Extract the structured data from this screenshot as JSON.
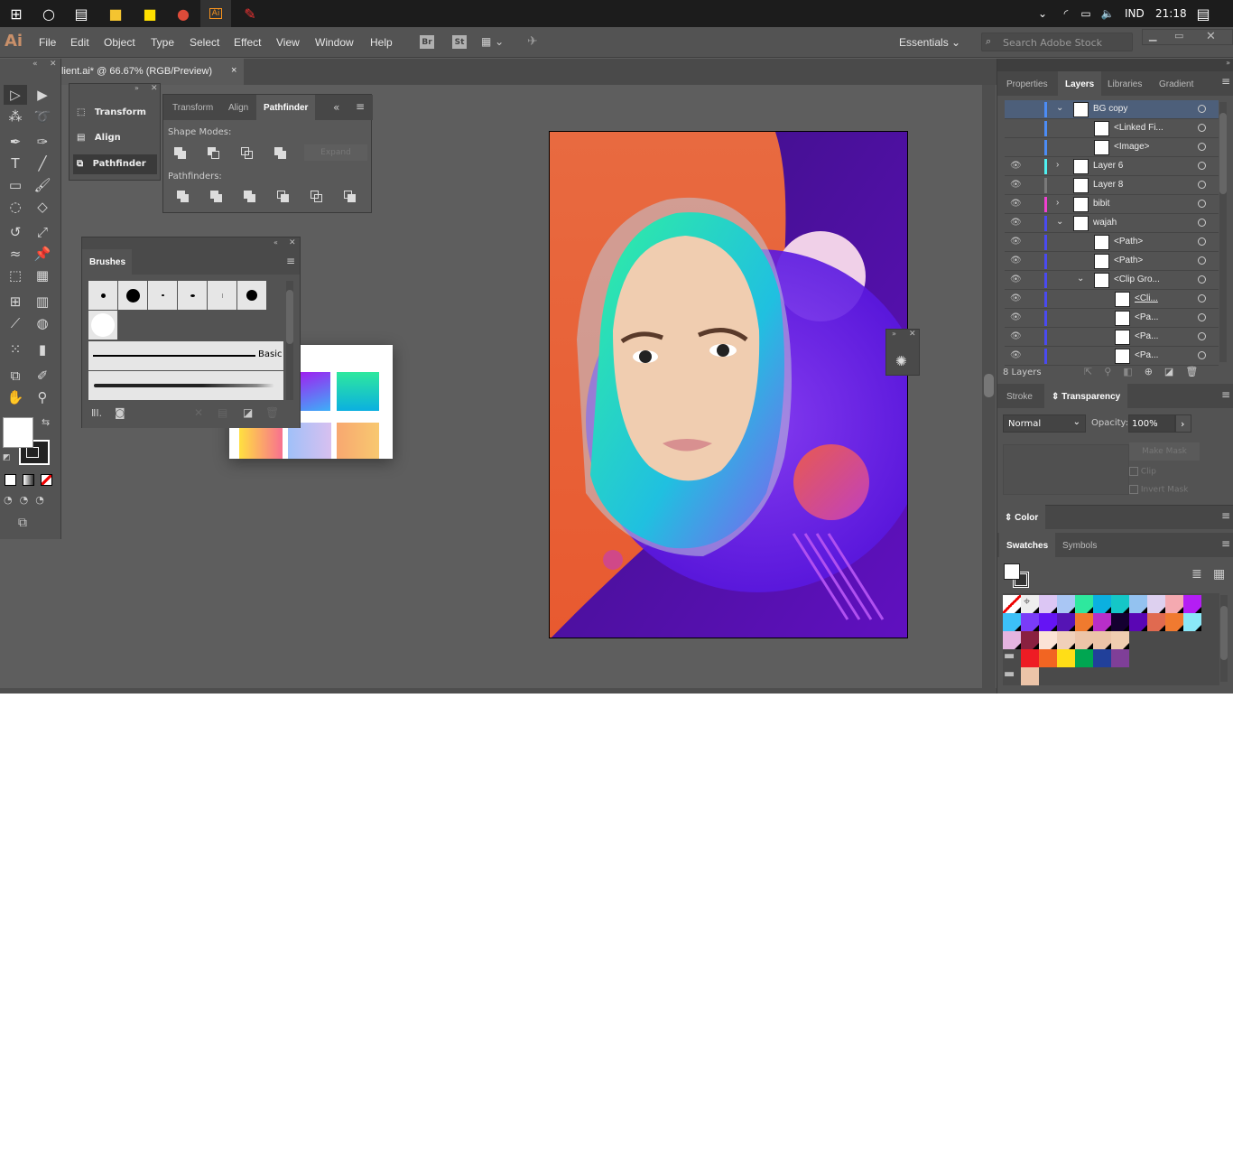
{
  "taskbar": {
    "tray_lang": "IND",
    "time": "21:18",
    "apps": [
      "start",
      "cortana",
      "task-view",
      "file-explorer",
      "sticky-notes",
      "chrome",
      "illustrator",
      "paint"
    ]
  },
  "menubar": {
    "logo": "Ai",
    "items": [
      "File",
      "Edit",
      "Object",
      "Type",
      "Select",
      "Effect",
      "View",
      "Window",
      "Help"
    ],
    "bridge": "Br",
    "stock": "St",
    "workspace": "Essentials",
    "search_placeholder": "Search Adobe Stock"
  },
  "document": {
    "tab_title": "lient.ai* @ 66.67% (RGB/Preview)",
    "close": "×"
  },
  "collapsed_panels": {
    "items": [
      "Transform",
      "Align",
      "Pathfinder"
    ]
  },
  "pathfinder_panel": {
    "tabs": [
      "Transform",
      "Align",
      "Pathfinder"
    ],
    "active_tab": "Pathfinder",
    "shape_modes_label": "Shape Modes:",
    "pathfinders_label": "Pathfinders:",
    "expand_label": "Expand"
  },
  "brushes_panel": {
    "tab": "Brushes",
    "basic_label": "Basic"
  },
  "right_panel": {
    "tabs": [
      "Properties",
      "Layers",
      "Libraries",
      "Gradient"
    ],
    "active_tab": "Layers",
    "layers": [
      {
        "name": "BG copy",
        "visible": false,
        "color": "#4c8cf5",
        "expanded": true,
        "selected": true
      },
      {
        "name": "<Linked Fi...",
        "visible": false,
        "color": "#4c8cf5"
      },
      {
        "name": "<Image>",
        "visible": false,
        "color": "#4c8cf5"
      },
      {
        "name": "Layer 6",
        "visible": true,
        "color": "#4ff0f0",
        "expanded": false
      },
      {
        "name": "Layer 8",
        "visible": true,
        "color": "#7a7a7a"
      },
      {
        "name": "bibit",
        "visible": true,
        "color": "#f040d0",
        "expanded": false
      },
      {
        "name": "wajah",
        "visible": true,
        "color": "#4a4af0",
        "expanded": true
      },
      {
        "name": "<Path>",
        "visible": true,
        "color": "#4a4af0"
      },
      {
        "name": "<Path>",
        "visible": true,
        "color": "#4a4af0"
      },
      {
        "name": "<Clip Gro...",
        "visible": true,
        "color": "#4a4af0",
        "expanded": true
      },
      {
        "name": "<Cli...",
        "visible": true,
        "color": "#4a4af0"
      },
      {
        "name": "<Pa...",
        "visible": true,
        "color": "#4a4af0"
      },
      {
        "name": "<Pa...",
        "visible": true,
        "color": "#4a4af0"
      },
      {
        "name": "<Pa...",
        "visible": true,
        "color": "#4a4af0"
      }
    ],
    "layer_count": "8 Layers",
    "stroke_tab": "Stroke",
    "transparency_tab": "Transparency",
    "blend_mode": "Normal",
    "opacity_label": "Opacity:",
    "opacity_value": "100%",
    "make_mask": "Make Mask",
    "clip_label": "Clip",
    "invert_mask_label": "Invert Mask",
    "color_tab": "Color",
    "swatches_tab": "Swatches",
    "symbols_tab": "Symbols",
    "swatches": [
      [
        "none",
        "registration",
        "#dcc6f4",
        "#a9c6f4",
        "#2ee89e",
        "#0bb0e0",
        "#14c7c7",
        "#93c2f0",
        "#ddd0ef",
        "#f4a9b0",
        "#b41ef4"
      ],
      [
        "#3cc0f8",
        "#7a3cf8",
        "#6514f4",
        "#5514b4",
        "#f07a2e",
        "#b82ec8",
        "#140030",
        "#5a06b4",
        "#e06a50",
        "#f07a30",
        "#8ae8f8"
      ],
      [
        "#e4b4e0",
        "#8a2040",
        "#fbe3d6",
        "#f0d0ba",
        "#ecc4a8",
        "#ecc4a8",
        "#f0cdb0"
      ],
      [
        "#ee1c24",
        "#f26522",
        "#ffde17",
        "#00a651",
        "#21409a",
        "#7f3f98"
      ],
      [
        "#ecc4a8"
      ]
    ]
  },
  "colors": {
    "accent": "#4c8cf5",
    "ui_bg": "#535353",
    "canvas_bg": "#5e5e5e"
  }
}
